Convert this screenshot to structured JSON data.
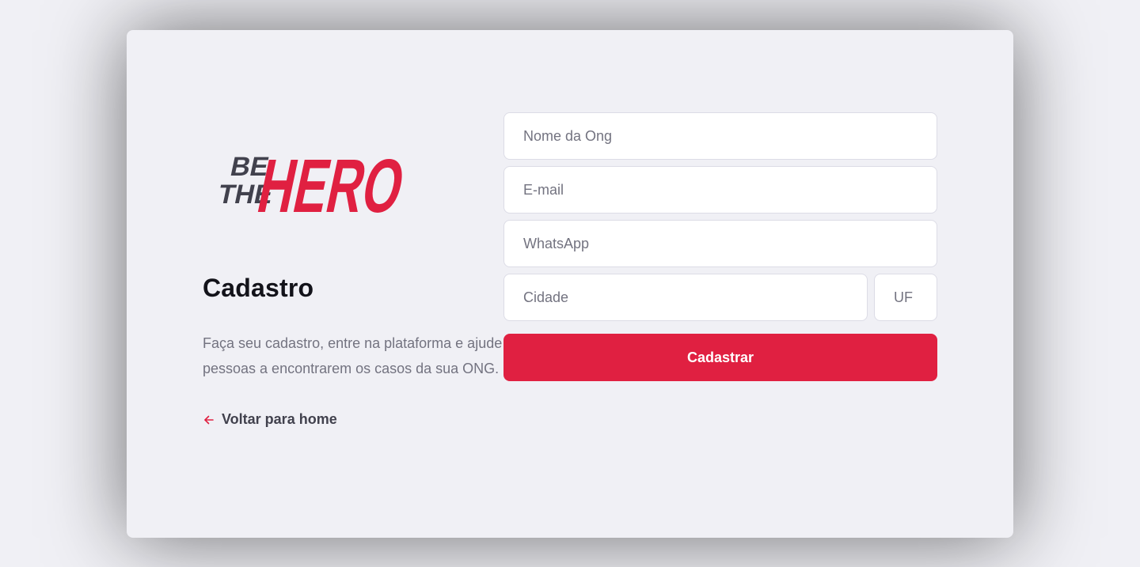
{
  "brand": {
    "logo_small_words": [
      "BE",
      "THE"
    ],
    "logo_big_word": "HERO",
    "primary_color": "#e02041",
    "dark_color": "#41414d"
  },
  "page": {
    "title": "Cadastro",
    "description": "Faça seu cadastro, entre na plataforma e ajude pessoas a encontrarem os casos da sua ONG.",
    "back_link": {
      "icon": "arrow-left-icon",
      "label": "Voltar para home"
    }
  },
  "form": {
    "name": {
      "placeholder": "Nome da Ong",
      "value": ""
    },
    "email": {
      "placeholder": "E-mail",
      "value": ""
    },
    "whatsapp": {
      "placeholder": "WhatsApp",
      "value": ""
    },
    "city": {
      "placeholder": "Cidade",
      "value": ""
    },
    "uf": {
      "placeholder": "UF",
      "value": ""
    },
    "submit_label": "Cadastrar"
  }
}
